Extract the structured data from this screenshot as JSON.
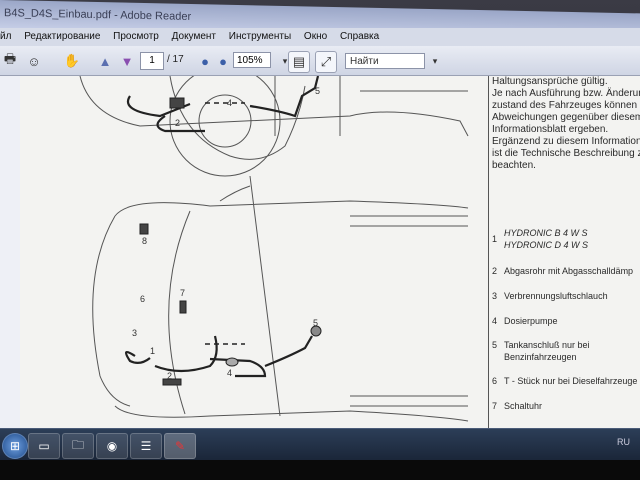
{
  "window": {
    "title": "B4S_D4S_Einbau.pdf - Adobe Reader"
  },
  "menu": {
    "items": [
      "йл",
      "Редактирование",
      "Просмотр",
      "Документ",
      "Инструменты",
      "Окно",
      "Справка"
    ]
  },
  "toolbar": {
    "page_current": "1",
    "page_total": "/ 17",
    "zoom": "105%",
    "search_placeholder": "Найти"
  },
  "document": {
    "right_paragraph": [
      "Haltungsansprüche gültig.",
      "Je nach Ausführung bzw. Änderun",
      "zustand des Fahrzeuges können s",
      "Abweichungen gegenüber diesem",
      "Informationsblatt ergeben.",
      "Ergänzend zu diesem Informationen",
      "ist die Technische Beschreibung z",
      "beachten."
    ],
    "legend": [
      {
        "num": "1",
        "lines": [
          "HYDRONIC B 4 W S",
          "HYDRONIC D 4 W S"
        ]
      },
      {
        "num": "2",
        "lines": [
          "Abgasrohr mit Abgasschalldämp"
        ]
      },
      {
        "num": "3",
        "lines": [
          "Verbrennungsluftschlauch"
        ]
      },
      {
        "num": "4",
        "lines": [
          "Dosierpumpe"
        ]
      },
      {
        "num": "5",
        "lines": [
          "Tankanschluß nur bei",
          "Benzinfahrzeugen"
        ]
      },
      {
        "num": "6",
        "lines": [
          "T - Stück nur bei Dieselfahrzeuge"
        ]
      },
      {
        "num": "7",
        "lines": [
          "Schaltuhr"
        ]
      }
    ],
    "diagram_labels": [
      "1",
      "2",
      "3",
      "4",
      "5",
      "6",
      "7",
      "8"
    ]
  },
  "taskbar": {
    "tray_lang": "RU"
  },
  "colors": {
    "titlebar": "#b4bdd9",
    "toolbar": "#dde1ec",
    "page": "#f3f3f1",
    "taskbar": "#22304a"
  }
}
